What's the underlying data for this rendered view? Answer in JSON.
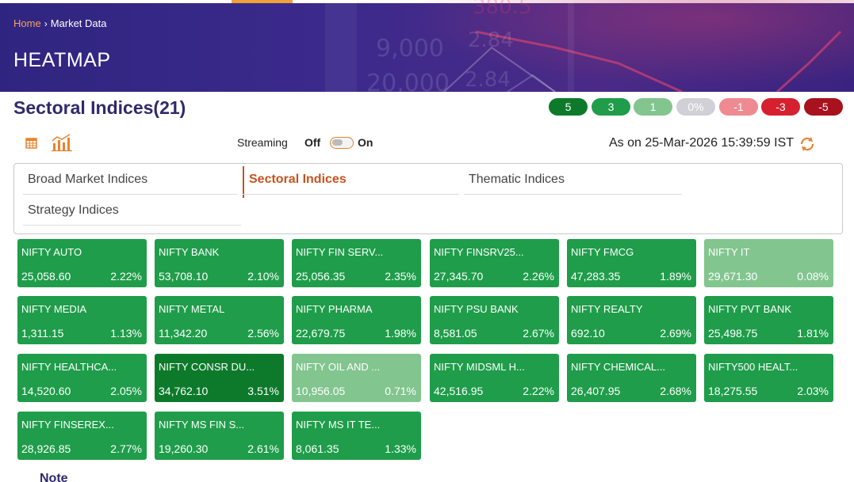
{
  "breadcrumb": {
    "home": "Home",
    "separator": "›",
    "current": "Market Data"
  },
  "hero": {
    "title": "HEATMAP",
    "bg_numbers": [
      "9,000",
      "20,000",
      "2.84",
      "2.84",
      "380.5"
    ]
  },
  "section": {
    "title": "Sectoral Indices(21)"
  },
  "legend": [
    {
      "label": "5",
      "color": "#0d7a2b"
    },
    {
      "label": "3",
      "color": "#1f9d4a"
    },
    {
      "label": "1",
      "color": "#82c58f"
    },
    {
      "label": "0%",
      "color": "#d0d0d6"
    },
    {
      "label": "-1",
      "color": "#f08a92"
    },
    {
      "label": "-3",
      "color": "#d6202f"
    },
    {
      "label": "-5",
      "color": "#a8111e"
    }
  ],
  "toolbar": {
    "table_icon": "table-icon",
    "chart_icon": "bar-chart-icon",
    "streaming_label": "Streaming",
    "off_label": "Off",
    "on_label": "On",
    "as_on": "As on 25-Mar-2026 15:39:59 IST",
    "refresh_icon": "refresh-icon"
  },
  "tabs": [
    {
      "label": "Broad Market Indices",
      "active": false
    },
    {
      "label": "Sectoral Indices",
      "active": true
    },
    {
      "label": "Thematic Indices",
      "active": false
    },
    {
      "label": "Strategy Indices",
      "active": false
    }
  ],
  "tiles": [
    {
      "name": "NIFTY AUTO",
      "value": "25,058.60",
      "change": "2.22%",
      "color": "#1f9d4a"
    },
    {
      "name": "NIFTY BANK",
      "value": "53,708.10",
      "change": "2.10%",
      "color": "#1f9d4a"
    },
    {
      "name": "NIFTY FIN SERV...",
      "value": "25,056.35",
      "change": "2.35%",
      "color": "#1f9d4a"
    },
    {
      "name": "NIFTY FINSRV25...",
      "value": "27,345.70",
      "change": "2.26%",
      "color": "#1f9d4a"
    },
    {
      "name": "NIFTY FMCG",
      "value": "47,283.35",
      "change": "1.89%",
      "color": "#1f9d4a"
    },
    {
      "name": "NIFTY IT",
      "value": "29,671.30",
      "change": "0.08%",
      "color": "#82c58f"
    },
    {
      "name": "NIFTY MEDIA",
      "value": "1,311.15",
      "change": "1.13%",
      "color": "#1f9d4a"
    },
    {
      "name": "NIFTY METAL",
      "value": "11,342.20",
      "change": "2.56%",
      "color": "#1f9d4a"
    },
    {
      "name": "NIFTY PHARMA",
      "value": "22,679.75",
      "change": "1.98%",
      "color": "#1f9d4a"
    },
    {
      "name": "NIFTY PSU BANK",
      "value": "8,581.05",
      "change": "2.67%",
      "color": "#1f9d4a"
    },
    {
      "name": "NIFTY REALTY",
      "value": "692.10",
      "change": "2.69%",
      "color": "#1f9d4a"
    },
    {
      "name": "NIFTY PVT BANK",
      "value": "25,498.75",
      "change": "1.81%",
      "color": "#1f9d4a"
    },
    {
      "name": "NIFTY HEALTHCA...",
      "value": "14,520.60",
      "change": "2.05%",
      "color": "#1f9d4a"
    },
    {
      "name": "NIFTY CONSR DU...",
      "value": "34,762.10",
      "change": "3.51%",
      "color": "#0d7a2b"
    },
    {
      "name": "NIFTY OIL AND ...",
      "value": "10,956.05",
      "change": "0.71%",
      "color": "#82c58f"
    },
    {
      "name": "NIFTY MIDSML H...",
      "value": "42,516.95",
      "change": "2.22%",
      "color": "#1f9d4a"
    },
    {
      "name": "NIFTY CHEMICAL...",
      "value": "26,407.95",
      "change": "2.68%",
      "color": "#1f9d4a"
    },
    {
      "name": "NIFTY500 HEALT...",
      "value": "18,275.55",
      "change": "2.03%",
      "color": "#1f9d4a"
    },
    {
      "name": "NIFTY FINSEREX...",
      "value": "28,926.85",
      "change": "2.77%",
      "color": "#1f9d4a"
    },
    {
      "name": "NIFTY MS FIN S...",
      "value": "19,260.30",
      "change": "2.61%",
      "color": "#1f9d4a"
    },
    {
      "name": "NIFTY MS IT TE...",
      "value": "8,061.35",
      "change": "1.33%",
      "color": "#1f9d4a"
    }
  ],
  "note": {
    "title": "Note"
  }
}
